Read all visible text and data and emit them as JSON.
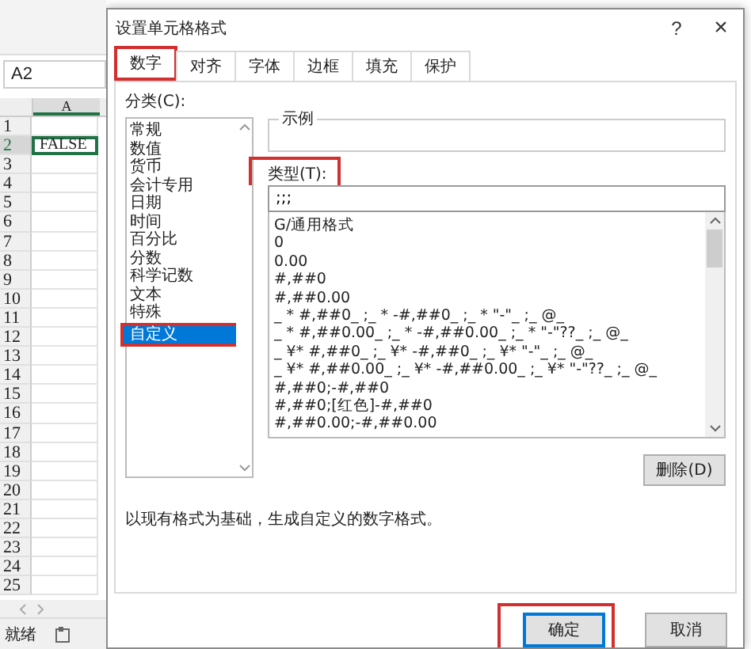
{
  "sheet": {
    "name_box": "A2",
    "column": "A",
    "rows": [
      {
        "label": "1",
        "selected": false
      },
      {
        "label": "2",
        "selected": true
      },
      {
        "label": "3",
        "selected": false
      },
      {
        "label": "4",
        "selected": false
      },
      {
        "label": "5",
        "selected": false
      },
      {
        "label": "6",
        "selected": false
      },
      {
        "label": "7",
        "selected": false
      },
      {
        "label": "8",
        "selected": false
      },
      {
        "label": "9",
        "selected": false
      },
      {
        "label": "10",
        "selected": false
      },
      {
        "label": "11",
        "selected": false
      },
      {
        "label": "12",
        "selected": false
      },
      {
        "label": "13",
        "selected": false
      },
      {
        "label": "14",
        "selected": false
      },
      {
        "label": "15",
        "selected": false
      },
      {
        "label": "16",
        "selected": false
      },
      {
        "label": "17",
        "selected": false
      },
      {
        "label": "18",
        "selected": false
      },
      {
        "label": "19",
        "selected": false
      },
      {
        "label": "20",
        "selected": false
      },
      {
        "label": "21",
        "selected": false
      },
      {
        "label": "22",
        "selected": false
      },
      {
        "label": "23",
        "selected": false
      },
      {
        "label": "24",
        "selected": false
      },
      {
        "label": "25",
        "selected": false
      }
    ],
    "active_cell_value": "FALSE",
    "status": "就绪"
  },
  "dialog": {
    "title": "设置单元格格式",
    "help": "?",
    "close": "×",
    "tabs": [
      {
        "label": "数字",
        "selected": true,
        "highlighted": true
      },
      {
        "label": "对齐",
        "selected": false,
        "highlighted": false
      },
      {
        "label": "字体",
        "selected": false,
        "highlighted": false
      },
      {
        "label": "边框",
        "selected": false,
        "highlighted": false
      },
      {
        "label": "填充",
        "selected": false,
        "highlighted": false
      },
      {
        "label": "保护",
        "selected": false,
        "highlighted": false
      }
    ],
    "category_label": "分类(C):",
    "categories": [
      {
        "label": "常规",
        "selected": false,
        "highlighted": false
      },
      {
        "label": "数值",
        "selected": false,
        "highlighted": false
      },
      {
        "label": "货币",
        "selected": false,
        "highlighted": false
      },
      {
        "label": "会计专用",
        "selected": false,
        "highlighted": false
      },
      {
        "label": "日期",
        "selected": false,
        "highlighted": false
      },
      {
        "label": "时间",
        "selected": false,
        "highlighted": false
      },
      {
        "label": "百分比",
        "selected": false,
        "highlighted": false
      },
      {
        "label": "分数",
        "selected": false,
        "highlighted": false
      },
      {
        "label": "科学记数",
        "selected": false,
        "highlighted": false
      },
      {
        "label": "文本",
        "selected": false,
        "highlighted": false
      },
      {
        "label": "特殊",
        "selected": false,
        "highlighted": false
      },
      {
        "label": "自定义",
        "selected": true,
        "highlighted": true
      }
    ],
    "sample_label": "示例",
    "type": {
      "label": "类型(T):",
      "value": ";;;",
      "highlighted": true
    },
    "formats": [
      {
        "label": "G/通用格式",
        "selected": false
      },
      {
        "label": "0",
        "selected": false
      },
      {
        "label": "0.00",
        "selected": false
      },
      {
        "label": "#,##0",
        "selected": false
      },
      {
        "label": "#,##0.00",
        "selected": false
      },
      {
        "label": "_ * #,##0_ ;_ * -#,##0_ ;_ * \"-\"_ ;_ @_",
        "selected": false
      },
      {
        "label": "_ * #,##0.00_ ;_ * -#,##0.00_ ;_ * \"-\"??_ ;_ @_",
        "selected": false
      },
      {
        "label": "_ ¥* #,##0_ ;_ ¥* -#,##0_ ;_ ¥* \"-\"_ ;_ @_",
        "selected": false
      },
      {
        "label": "_ ¥* #,##0.00_ ;_ ¥* -#,##0.00_ ;_ ¥* \"-\"??_ ;_ @_",
        "selected": false
      },
      {
        "label": "#,##0;-#,##0",
        "selected": false
      },
      {
        "label": "#,##0;[红色]-#,##0",
        "selected": false
      },
      {
        "label": "#,##0.00;-#,##0.00",
        "selected": false
      }
    ],
    "delete_button": "删除(D)",
    "description": "以现有格式为基础，生成自定义的数字格式。",
    "buttons": [
      {
        "label": "确定",
        "kind": "primary",
        "highlighted": true
      },
      {
        "label": "取消",
        "kind": "secondary",
        "highlighted": false
      }
    ]
  }
}
